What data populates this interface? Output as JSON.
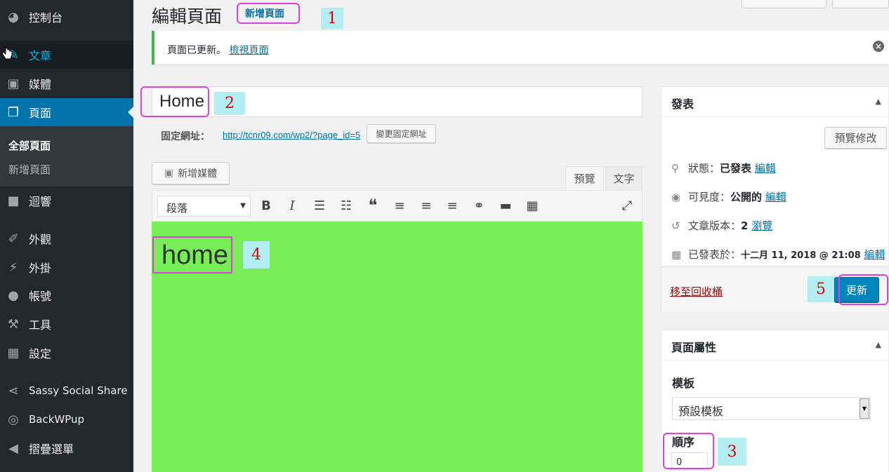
{
  "sidebar": {
    "items": [
      {
        "label": "控制台",
        "icon": "dashboard-icon"
      },
      {
        "label": "文章",
        "icon": "pin-icon"
      },
      {
        "label": "媒體",
        "icon": "media-icon"
      },
      {
        "label": "頁面",
        "icon": "pages-icon"
      },
      {
        "label": "迴響",
        "icon": "comments-icon"
      },
      {
        "label": "外觀",
        "icon": "appearance-icon"
      },
      {
        "label": "外掛",
        "icon": "plugins-icon"
      },
      {
        "label": "帳號",
        "icon": "users-icon"
      },
      {
        "label": "工具",
        "icon": "tools-icon"
      },
      {
        "label": "設定",
        "icon": "settings-icon"
      },
      {
        "label": "Sassy Social Share",
        "icon": "share-icon"
      },
      {
        "label": "BackWPup",
        "icon": "backwpup-icon"
      },
      {
        "label": "摺疊選單",
        "icon": "collapse-icon"
      }
    ],
    "submenu": {
      "all_pages": "全部頁面",
      "add_new": "新增頁面"
    }
  },
  "header": {
    "title": "編輯頁面",
    "add_new": "新增頁面"
  },
  "notice": {
    "text": "頁面已更新。",
    "link": "檢視頁面"
  },
  "post": {
    "title": "Home",
    "permalink_label": "固定網址：",
    "permalink_url": "http://tcnr09.com/wp2/?page_id=5",
    "change_permalink": "變更固定網址"
  },
  "editor": {
    "add_media": "新增媒體",
    "tab_visual": "預覽",
    "tab_text": "文字",
    "format": "段落",
    "content": "home"
  },
  "publish": {
    "title": "發表",
    "preview_button": "預覽修改",
    "status_label": "狀態：",
    "status_value": "已發表",
    "visibility_label": "可見度：",
    "visibility_value": "公開的",
    "revisions_label": "文章版本：",
    "revisions_value": "2",
    "browse": "瀏覽",
    "published_label": "已發表於：",
    "published_value": "十二月 11, 2018 @ 21:08",
    "edit": "編輯",
    "trash": "移至回收桶",
    "update": "更新"
  },
  "attributes": {
    "title": "頁面屬性",
    "template_label": "模板",
    "template_value": "預設模板",
    "order_label": "順序",
    "order_value": "0"
  },
  "annotations": [
    "1",
    "2",
    "3",
    "4",
    "5"
  ],
  "colors": {
    "accent": "#0073aa",
    "editor_bg": "#77ee55",
    "highlight": "#e040e0",
    "label_bg": "#b2eef2"
  }
}
